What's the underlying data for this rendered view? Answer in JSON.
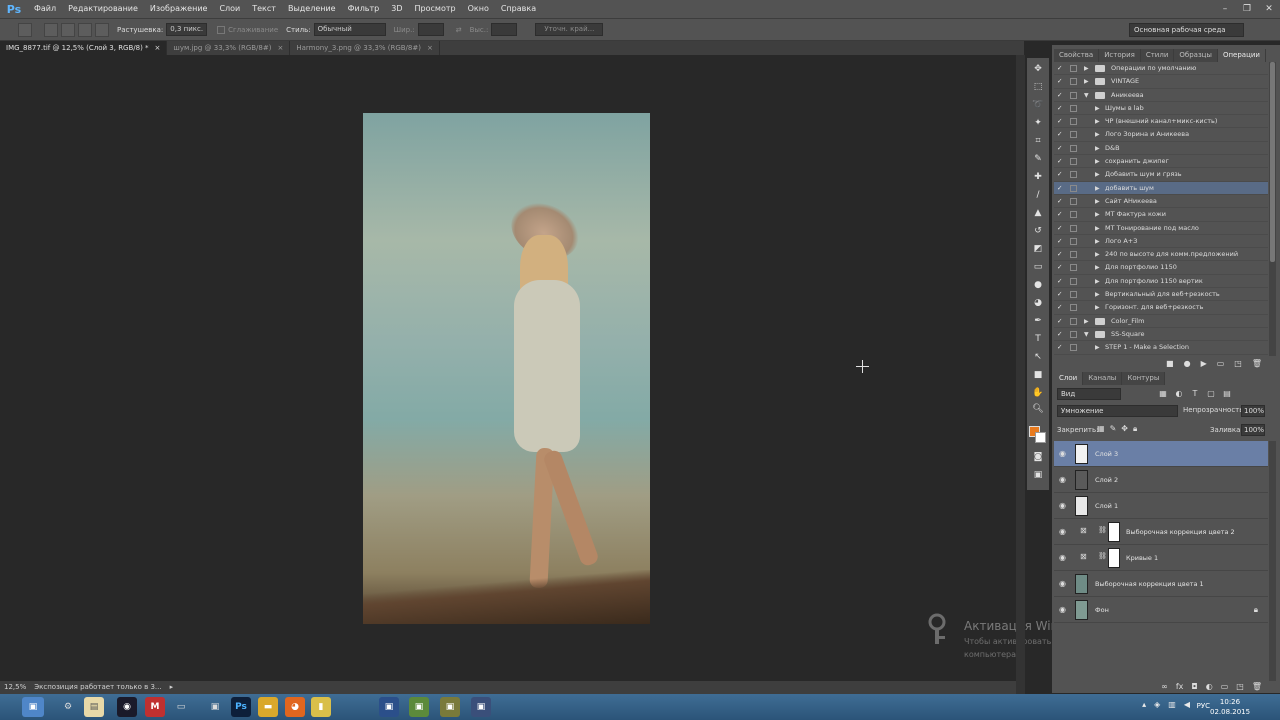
{
  "app": {
    "logo": "Ps",
    "menu": [
      "Файл",
      "Редактирование",
      "Изображение",
      "Слои",
      "Текст",
      "Выделение",
      "Фильтр",
      "3D",
      "Просмотр",
      "Окно",
      "Справка"
    ],
    "window_controls": [
      "–",
      "❐",
      "✕"
    ]
  },
  "options": {
    "feather_label": "Растушевка:",
    "feather_value": "0,3 пикс.",
    "smooth_label": "Сглаживание",
    "style_label": "Стиль:",
    "style_value": "Обычный",
    "width_label": "Шир.:",
    "height_label": "Выс.:",
    "refine_button": "Уточн. край...",
    "workspace": "Основная рабочая среда"
  },
  "tabs": [
    {
      "label": "IMG_8877.tif @ 12,5% (Слой 3, RGB/8) *",
      "close": "×"
    },
    {
      "label": "шум.jpg @ 33,3% (RGB/8#)",
      "close": "×"
    },
    {
      "label": "Harmony_3.png @ 33,3% (RGB/8#)",
      "close": "×"
    }
  ],
  "status": {
    "zoom": "12,5%",
    "text": "Экспозиция работает только в 3...",
    "arrow": "▸"
  },
  "watermark": {
    "title": "Активация Windows",
    "text": "Чтобы активировать Windows, перейдите к параметрам компьютера."
  },
  "panels": {
    "top_tabs": [
      "Свойства",
      "История",
      "Стили",
      "Образцы",
      "Операции"
    ],
    "active_top_tab": "Операции",
    "actions": [
      {
        "label": "Операции по умолчанию",
        "type": "set",
        "expanded": false
      },
      {
        "label": "VINTAGE",
        "type": "set",
        "expanded": false
      },
      {
        "label": "Аникеева",
        "type": "set",
        "expanded": true
      },
      {
        "label": "Шумы в lab",
        "type": "action"
      },
      {
        "label": "ЧР (внешний канал+микс-кисть)",
        "type": "action"
      },
      {
        "label": "Лого Зорина и Аникеева",
        "type": "action"
      },
      {
        "label": "D&B",
        "type": "action"
      },
      {
        "label": "сохранить джипег",
        "type": "action"
      },
      {
        "label": "Добавить шум и грязь",
        "type": "action"
      },
      {
        "label": "добавить шум",
        "type": "action",
        "selected": true
      },
      {
        "label": "Сайт АНикеева",
        "type": "action"
      },
      {
        "label": "МТ Фактура кожи",
        "type": "action"
      },
      {
        "label": "МТ Тонирование под масло",
        "type": "action"
      },
      {
        "label": "Лого А+З",
        "type": "action"
      },
      {
        "label": "240 по высоте для комм.предложений",
        "type": "action"
      },
      {
        "label": "Для портфолио 1150",
        "type": "action"
      },
      {
        "label": "Для портфолио 1150 вертик",
        "type": "action"
      },
      {
        "label": "Вертикальный для веб+резкость",
        "type": "action"
      },
      {
        "label": "Горизонт. для веб+резкость",
        "type": "action"
      },
      {
        "label": "Color_Film",
        "type": "set",
        "expanded": false
      },
      {
        "label": "SS-Square",
        "type": "set",
        "expanded": true
      },
      {
        "label": "STEP 1 - Make a Selection",
        "type": "action"
      }
    ],
    "layer_tabs": [
      "Слои",
      "Каналы",
      "Контуры"
    ],
    "active_layer_tab": "Слои",
    "kind": "Вид",
    "blend_mode": "Умножение",
    "opacity_label": "Непрозрачность:",
    "opacity_value": "100%",
    "lock_label": "Закрепить:",
    "fill_label": "Заливка:",
    "fill_value": "100%",
    "layers": [
      {
        "name": "Слой 3",
        "kind": "pixel",
        "thumb": "#f2f2f2",
        "selected": true
      },
      {
        "name": "Слой 2",
        "kind": "pixel",
        "thumb": "#5a5a5a"
      },
      {
        "name": "Слой 1",
        "kind": "pixel",
        "thumb": "#e8e8e8"
      },
      {
        "name": "Выборочная коррекция цвета 2",
        "kind": "adjustment"
      },
      {
        "name": "Кривые 1",
        "kind": "adjustment"
      },
      {
        "name": "Выборочная коррекция цвета 1",
        "kind": "image",
        "thumb": "#6f8c86"
      },
      {
        "name": "Фон",
        "kind": "image",
        "thumb": "#7f9a92",
        "locked": true
      }
    ]
  },
  "colors": {
    "foreground": "#e87a1e",
    "background": "#ffffff",
    "selection": "#6a7fa6"
  },
  "taskbar": {
    "lang": "РУС",
    "time": "10:26",
    "date": "02.08.2015"
  }
}
